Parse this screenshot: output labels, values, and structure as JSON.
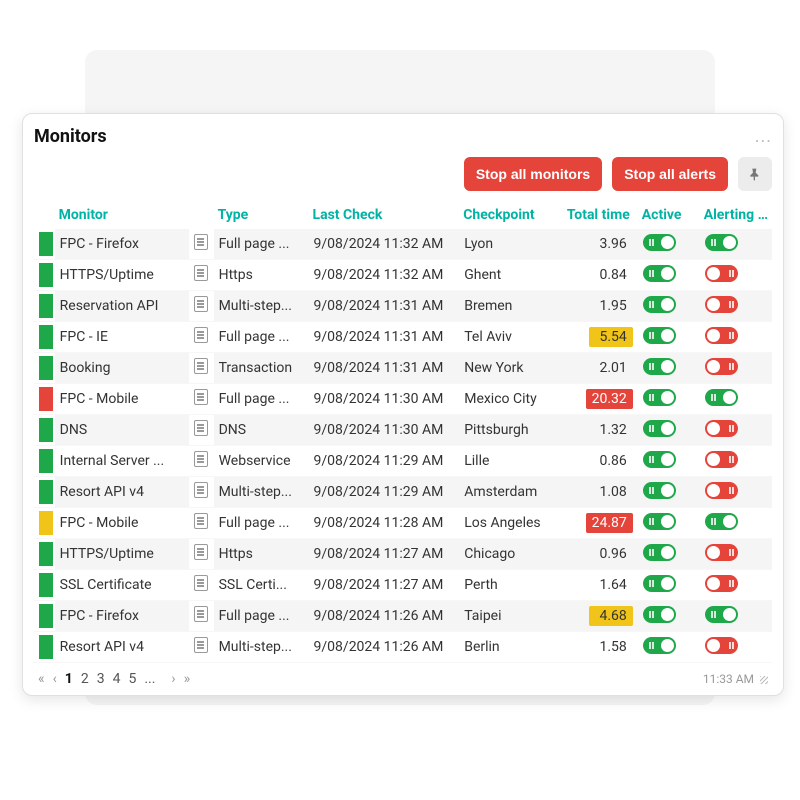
{
  "panel": {
    "title": "Monitors",
    "more": "...",
    "actions": {
      "stop_monitors": "Stop all monitors",
      "stop_alerts": "Stop all alerts"
    },
    "footer_time": "11:33 AM"
  },
  "columns": {
    "monitor": "Monitor",
    "type": "Type",
    "last_check": "Last Check",
    "checkpoint": "Checkpoint",
    "total_time": "Total time",
    "active": "Active",
    "alerting": "Alerting ..."
  },
  "pager": {
    "pages": [
      "1",
      "2",
      "3",
      "4",
      "5",
      "..."
    ],
    "active": "1"
  },
  "rows": [
    {
      "status": "green",
      "monitor": "FPC - Firefox",
      "type": "Full page ...",
      "last": "9/08/2024 11:32 AM",
      "checkpoint": "Lyon",
      "total": "3.96",
      "tt": "",
      "active": true,
      "alerting": true
    },
    {
      "status": "green",
      "monitor": "HTTPS/Uptime",
      "type": "Https",
      "last": "9/08/2024 11:32 AM",
      "checkpoint": "Ghent",
      "total": "0.84",
      "tt": "",
      "active": true,
      "alerting": false
    },
    {
      "status": "green",
      "monitor": "Reservation API",
      "type": "Multi-step...",
      "last": "9/08/2024 11:31 AM",
      "checkpoint": "Bremen",
      "total": "1.95",
      "tt": "",
      "active": true,
      "alerting": false
    },
    {
      "status": "green",
      "monitor": "FPC - IE",
      "type": "Full page ...",
      "last": "9/08/2024 11:31 AM",
      "checkpoint": "Tel Aviv",
      "total": "5.54",
      "tt": "warn",
      "active": true,
      "alerting": false
    },
    {
      "status": "green",
      "monitor": "Booking",
      "type": "Transaction",
      "last": "9/08/2024 11:31 AM",
      "checkpoint": "New York",
      "total": "2.01",
      "tt": "",
      "active": true,
      "alerting": false
    },
    {
      "status": "red",
      "monitor": "FPC - Mobile",
      "type": "Full page ...",
      "last": "9/08/2024 11:30 AM",
      "checkpoint": "Mexico City",
      "total": "20.32",
      "tt": "crit",
      "active": true,
      "alerting": true
    },
    {
      "status": "green",
      "monitor": "DNS",
      "type": "DNS",
      "last": "9/08/2024 11:30 AM",
      "checkpoint": "Pittsburgh",
      "total": "1.32",
      "tt": "",
      "active": true,
      "alerting": false
    },
    {
      "status": "green",
      "monitor": "Internal Server ...",
      "type": "Webservice",
      "last": "9/08/2024 11:29 AM",
      "checkpoint": "Lille",
      "total": "0.86",
      "tt": "",
      "active": true,
      "alerting": false
    },
    {
      "status": "green",
      "monitor": "Resort API v4",
      "type": "Multi-step...",
      "last": "9/08/2024 11:29 AM",
      "checkpoint": "Amsterdam",
      "total": "1.08",
      "tt": "",
      "active": true,
      "alerting": false
    },
    {
      "status": "yellow",
      "monitor": "FPC - Mobile",
      "type": "Full page ...",
      "last": "9/08/2024 11:28 AM",
      "checkpoint": "Los Angeles",
      "total": "24.87",
      "tt": "crit",
      "active": true,
      "alerting": true
    },
    {
      "status": "green",
      "monitor": "HTTPS/Uptime",
      "type": "Https",
      "last": "9/08/2024 11:27 AM",
      "checkpoint": "Chicago",
      "total": "0.96",
      "tt": "",
      "active": true,
      "alerting": false
    },
    {
      "status": "green",
      "monitor": "SSL Certificate",
      "type": "SSL Certi...",
      "last": "9/08/2024 11:27 AM",
      "checkpoint": "Perth",
      "total": "1.64",
      "tt": "",
      "active": true,
      "alerting": false
    },
    {
      "status": "green",
      "monitor": "FPC - Firefox",
      "type": "Full page ...",
      "last": "9/08/2024 11:26 AM",
      "checkpoint": "Taipei",
      "total": "4.68",
      "tt": "warn",
      "active": true,
      "alerting": true
    },
    {
      "status": "green",
      "monitor": "Resort API v4",
      "type": "Multi-step...",
      "last": "9/08/2024 11:26 AM",
      "checkpoint": "Berlin",
      "total": "1.58",
      "tt": "",
      "active": true,
      "alerting": false
    }
  ]
}
